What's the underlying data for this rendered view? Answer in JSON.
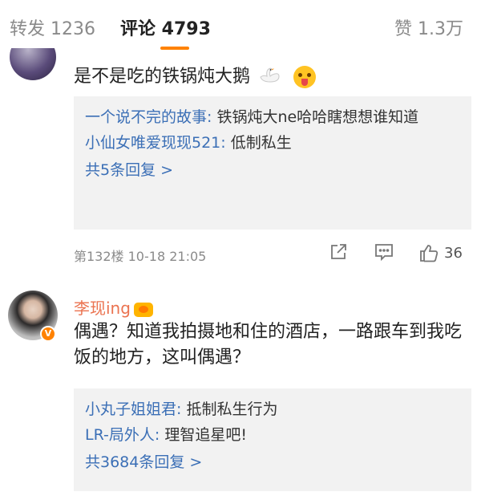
{
  "tabs": {
    "repost": "转发 1236",
    "comments": "评论 4793",
    "likes": "赞 1.3万"
  },
  "comment1": {
    "text": "是不是吃的铁锅炖大鹅",
    "emojis": [
      "goose-icon",
      "tongue-out-icon"
    ],
    "replies": [
      {
        "author": "一个说不完的故事:",
        "text": " 铁锅炖大ne哈哈瞎想想谁知道"
      },
      {
        "author": "小仙女唯爱现现521:",
        "text": " 低制私生"
      }
    ],
    "more": "共5条回复 >",
    "meta": "第132楼  10-18 21:05",
    "likes": "36"
  },
  "comment2": {
    "author": "李现ing",
    "text": "偶遇？知道我拍摄地和住的酒店，一路跟车到我吃饭的地方，这叫偶遇？",
    "replies": [
      {
        "author": "小丸子姐姐君:",
        "text": " 抵制私生行为"
      },
      {
        "author": "LR-局外人:",
        "text": " 理智追星吧!"
      }
    ],
    "more": "共3684条回复 >"
  },
  "colors": {
    "accent": "#ff8200",
    "link": "#3b6fb6",
    "username": "#eb7350"
  }
}
